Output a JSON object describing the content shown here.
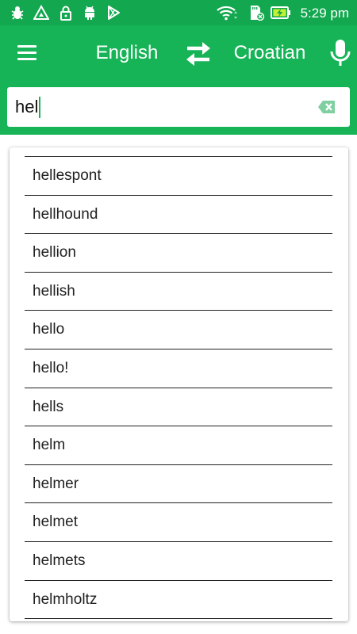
{
  "status_bar": {
    "time": "5:29 pm",
    "left_icons": [
      "bug-icon",
      "warning-icon",
      "lock-icon",
      "android-icon",
      "play-store-icon"
    ],
    "right_icons": [
      "wifi-icon",
      "sd-card-icon",
      "battery-charging-icon"
    ]
  },
  "app_bar": {
    "menu_icon": "hamburger-menu-icon",
    "source_language": "English",
    "swap_icon": "swap-arrows-icon",
    "target_language": "Croatian",
    "mic_icon": "microphone-icon",
    "accent_color": "#16b457"
  },
  "search": {
    "value": "hel",
    "placeholder": "",
    "clear_icon": "backspace-clear-icon"
  },
  "suggestions": {
    "items": [
      "hellespont",
      "hellhound",
      "hellion",
      "hellish",
      "hello",
      "hello!",
      "hells",
      "helm",
      "helmer",
      "helmet",
      "helmets",
      "helmholtz"
    ]
  }
}
